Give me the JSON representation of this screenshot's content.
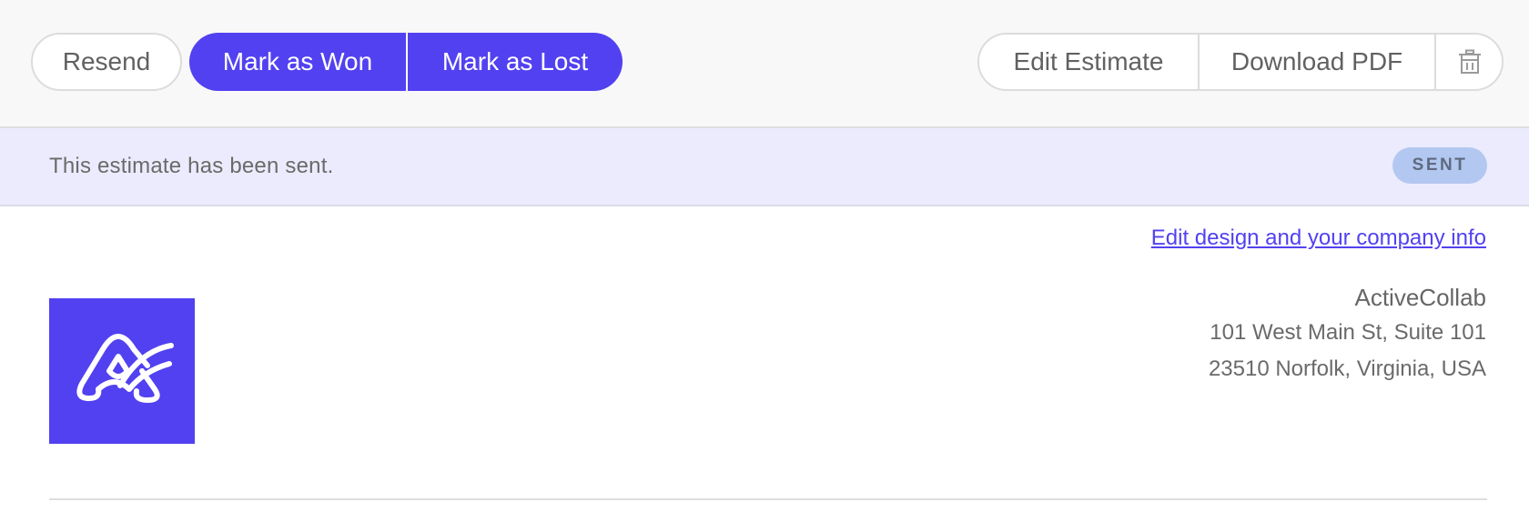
{
  "toolbar": {
    "resend_label": "Resend",
    "mark_won_label": "Mark as Won",
    "mark_lost_label": "Mark as Lost",
    "edit_estimate_label": "Edit Estimate",
    "download_pdf_label": "Download PDF",
    "delete_icon": "trash-icon"
  },
  "banner": {
    "message": "This estimate has been sent.",
    "status": "SENT"
  },
  "edit_link": "Edit design and your company info",
  "company": {
    "logo_icon": "activecollab-logo",
    "name": "ActiveCollab",
    "address_line1": "101 West Main St, Suite 101",
    "address_line2": "23510 Norfolk, Virginia, USA"
  },
  "colors": {
    "accent": "#5241f0",
    "banner_bg": "#ebebfd",
    "badge_bg": "#b3c8f0"
  }
}
